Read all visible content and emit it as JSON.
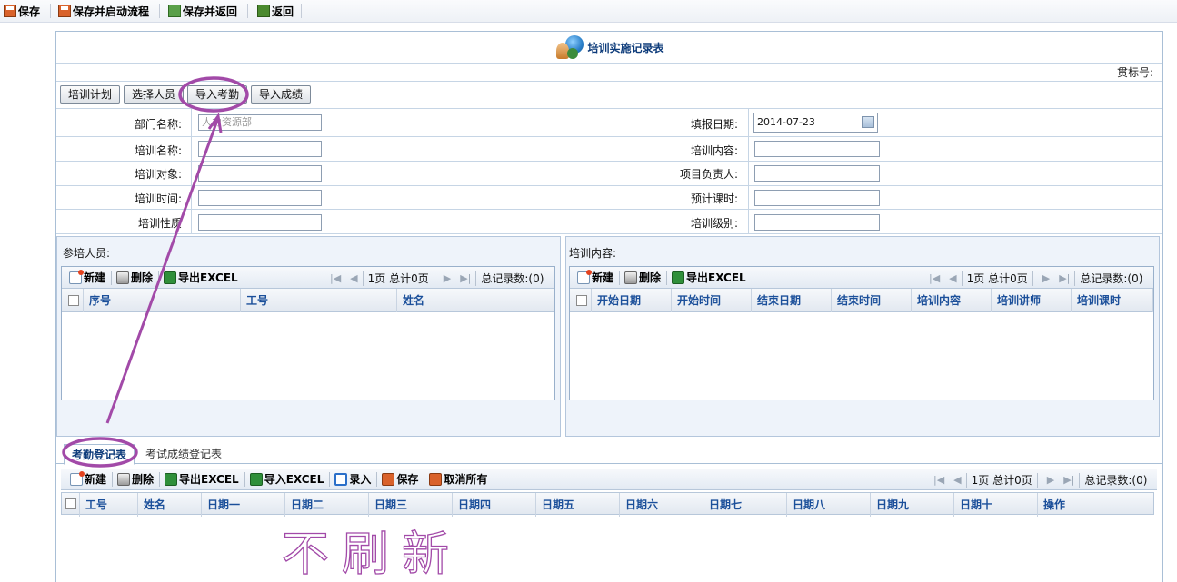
{
  "toolbar": {
    "save": "保存",
    "save_start": "保存并启动流程",
    "save_return": "保存并返回",
    "back": "返回"
  },
  "form": {
    "title": "培训实施记录表",
    "ref_label": "贯标号:",
    "buttons": {
      "plan": "培训计划",
      "select_staff": "选择人员",
      "import_attendance": "导入考勤",
      "import_scores": "导入成绩"
    },
    "fields": {
      "dept_label": "部门名称:",
      "dept_value": "人力资源部",
      "report_date_label": "填报日期:",
      "report_date_value": "2014-07-23",
      "name_label": "培训名称:",
      "content_label": "培训内容:",
      "target_label": "培训对象:",
      "owner_label": "项目负责人:",
      "time_label": "培训时间:",
      "hours_label": "预计课时:",
      "nature_label": "培训性质",
      "level_label": "培训级别:"
    }
  },
  "participants": {
    "title": "参培人员:",
    "toolbar": {
      "new": "新建",
      "delete": "删除",
      "export": "导出EXCEL"
    },
    "pager": {
      "page": "1页 总计0页",
      "total": "总记录数:(0)"
    },
    "columns": [
      "序号",
      "工号",
      "姓名"
    ]
  },
  "content_panel": {
    "title": "培训内容:",
    "toolbar": {
      "new": "新建",
      "delete": "删除",
      "export": "导出EXCEL"
    },
    "pager": {
      "page": "1页 总计0页",
      "total": "总记录数:(0)"
    },
    "columns": [
      "开始日期",
      "开始时间",
      "结束日期",
      "结束时间",
      "培训内容",
      "培训讲师",
      "培训课时"
    ]
  },
  "tabs": [
    "考勤登记表",
    "考试成绩登记表"
  ],
  "attendance": {
    "toolbar": {
      "new": "新建",
      "delete": "删除",
      "export": "导出EXCEL",
      "import": "导入EXCEL",
      "enter": "录入",
      "save": "保存",
      "cancel_all": "取消所有"
    },
    "pager": {
      "page": "1页 总计0页",
      "total": "总记录数:(0)"
    },
    "columns": [
      "工号",
      "姓名",
      "日期一",
      "日期二",
      "日期三",
      "日期四",
      "日期五",
      "日期六",
      "日期七",
      "日期八",
      "日期九",
      "日期十",
      "操作"
    ]
  },
  "annotation": {
    "handwriting": "不刷新",
    "color": "#a24aa8"
  }
}
